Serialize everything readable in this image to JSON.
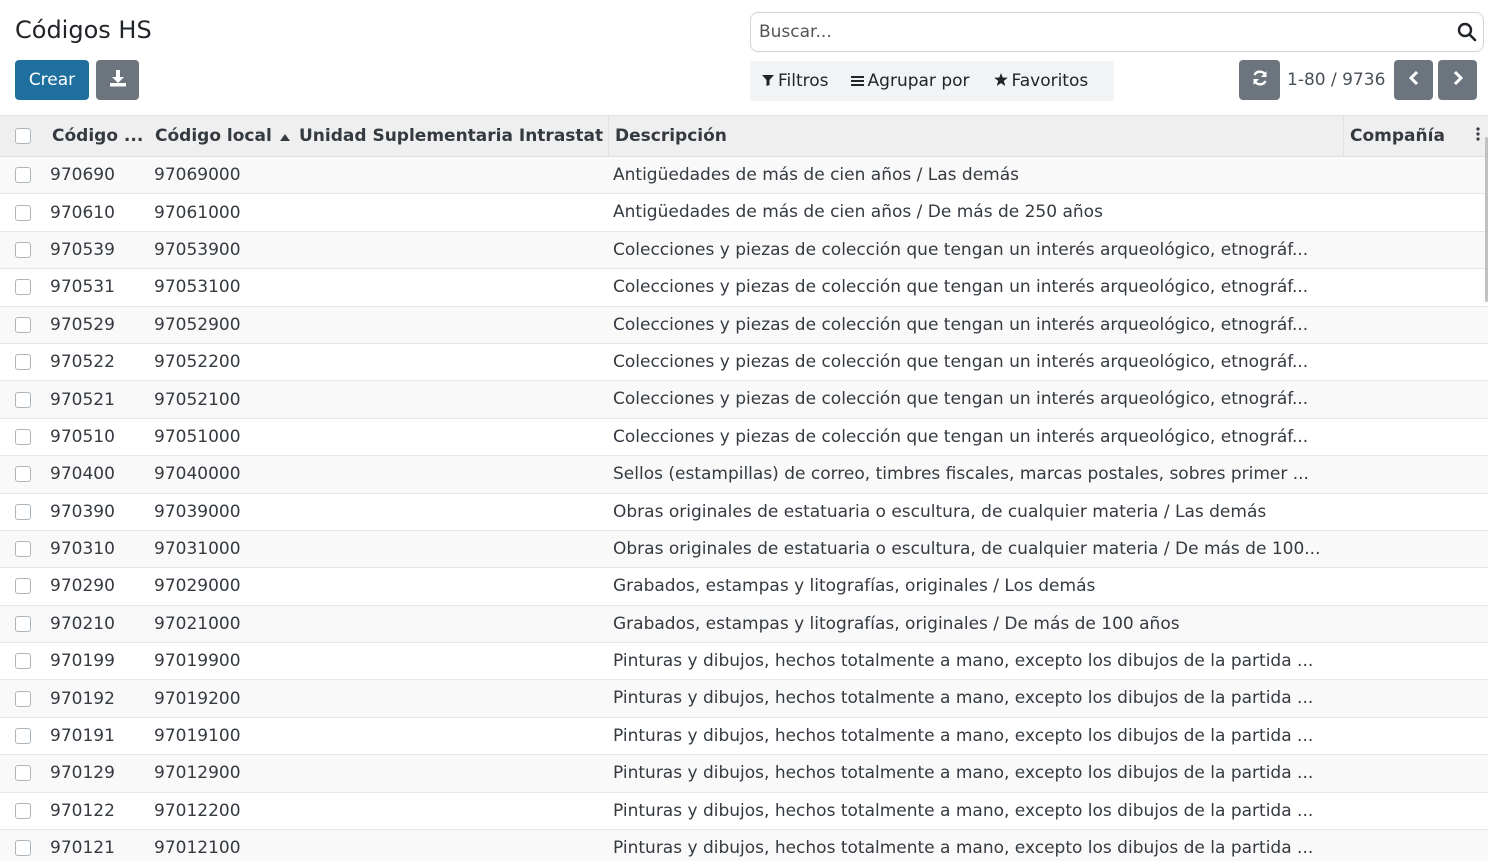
{
  "page": {
    "title": "Códigos HS"
  },
  "search": {
    "placeholder": "Buscar..."
  },
  "toolbar": {
    "create_label": "Crear"
  },
  "filters": {
    "filters_label": "Filtros",
    "group_by_label": "Agrupar por",
    "favorites_label": "Favoritos"
  },
  "pager": {
    "value": "1-80 / 9736"
  },
  "columns": {
    "code": "Código ...",
    "local_code": "Código local",
    "unit": "Unidad Suplementaria Intrastat",
    "description": "Descripción",
    "company": "Compañía"
  },
  "rows": [
    {
      "code": "970690",
      "local_code": "97069000",
      "description": "Antigüedades de más de cien años / Las demás"
    },
    {
      "code": "970610",
      "local_code": "97061000",
      "description": "Antigüedades de más de cien años / De más de 250 años"
    },
    {
      "code": "970539",
      "local_code": "97053900",
      "description": "Colecciones y piezas de colección que tengan un interés arqueológico, etnográf..."
    },
    {
      "code": "970531",
      "local_code": "97053100",
      "description": "Colecciones y piezas de colección que tengan un interés arqueológico, etnográf..."
    },
    {
      "code": "970529",
      "local_code": "97052900",
      "description": "Colecciones y piezas de colección que tengan un interés arqueológico, etnográf..."
    },
    {
      "code": "970522",
      "local_code": "97052200",
      "description": "Colecciones y piezas de colección que tengan un interés arqueológico, etnográf..."
    },
    {
      "code": "970521",
      "local_code": "97052100",
      "description": "Colecciones y piezas de colección que tengan un interés arqueológico, etnográf..."
    },
    {
      "code": "970510",
      "local_code": "97051000",
      "description": "Colecciones y piezas de colección que tengan un interés arqueológico, etnográf..."
    },
    {
      "code": "970400",
      "local_code": "97040000",
      "description": "Sellos (estampillas) de correo, timbres fiscales, marcas postales, sobres primer ..."
    },
    {
      "code": "970390",
      "local_code": "97039000",
      "description": "Obras originales de estatuaria o escultura, de cualquier materia / Las demás"
    },
    {
      "code": "970310",
      "local_code": "97031000",
      "description": "Obras originales de estatuaria o escultura, de cualquier materia / De más de 100..."
    },
    {
      "code": "970290",
      "local_code": "97029000",
      "description": "Grabados, estampas y litografías, originales / Los demás"
    },
    {
      "code": "970210",
      "local_code": "97021000",
      "description": "Grabados, estampas y litografías, originales / De más de 100 años"
    },
    {
      "code": "970199",
      "local_code": "97019900",
      "description": "Pinturas y dibujos, hechos totalmente a mano, excepto los dibujos de la partida ..."
    },
    {
      "code": "970192",
      "local_code": "97019200",
      "description": "Pinturas y dibujos, hechos totalmente a mano, excepto los dibujos de la partida ..."
    },
    {
      "code": "970191",
      "local_code": "97019100",
      "description": "Pinturas y dibujos, hechos totalmente a mano, excepto los dibujos de la partida ..."
    },
    {
      "code": "970129",
      "local_code": "97012900",
      "description": "Pinturas y dibujos, hechos totalmente a mano, excepto los dibujos de la partida ..."
    },
    {
      "code": "970122",
      "local_code": "97012200",
      "description": "Pinturas y dibujos, hechos totalmente a mano, excepto los dibujos de la partida ..."
    },
    {
      "code": "970121",
      "local_code": "97012100",
      "description": "Pinturas y dibujos, hechos totalmente a mano, excepto los dibujos de la partida ..."
    }
  ],
  "icons": {
    "search": "search-icon",
    "download": "download-icon",
    "filter": "filter-icon",
    "group_by": "list-icon",
    "favorites": "star-icon",
    "reload": "refresh-icon",
    "prev": "chevron-left-icon",
    "next": "chevron-right-icon",
    "sort": "caret-up-icon",
    "options": "kebab-icon"
  },
  "colors": {
    "primary": "#1f6f9f",
    "secondary": "#6c757d",
    "header_bg": "#efefef"
  }
}
